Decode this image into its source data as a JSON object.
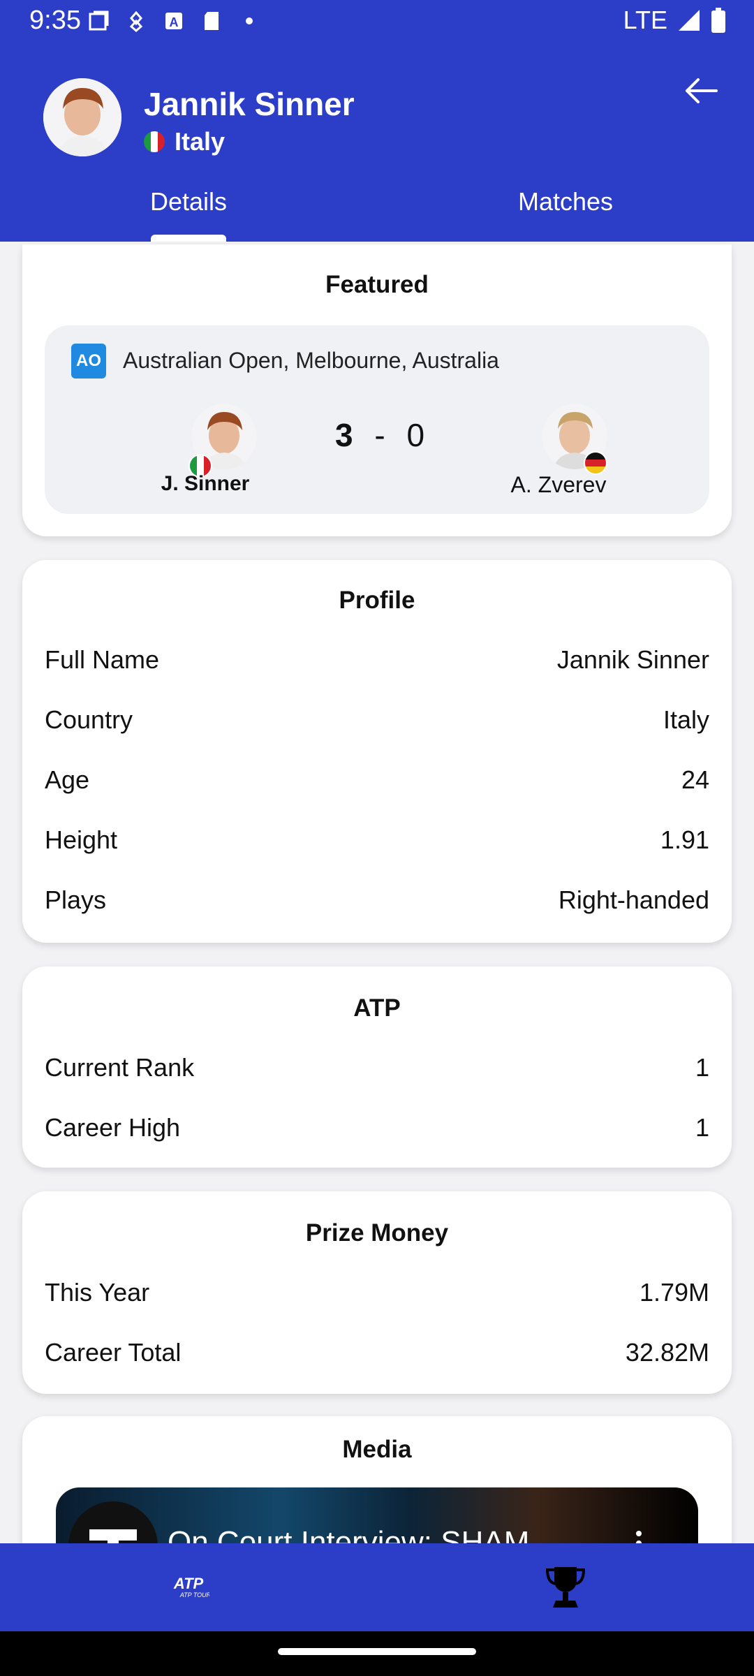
{
  "status_bar": {
    "time": "9:35",
    "network": "LTE"
  },
  "header": {
    "player_name": "Jannik Sinner",
    "country": "Italy",
    "back_icon": "arrow-left-icon"
  },
  "tabs": [
    {
      "label": "Details",
      "active": true
    },
    {
      "label": "Matches",
      "active": false
    }
  ],
  "featured": {
    "title": "Featured",
    "tournament_icon_text": "AO",
    "tournament": "Australian Open, Melbourne, Australia",
    "player1": {
      "name": "J. Sinner",
      "score": "3"
    },
    "score_separator": "-",
    "player2": {
      "name": "A. Zverev",
      "score": "0"
    }
  },
  "profile": {
    "title": "Profile",
    "rows": [
      {
        "label": "Full Name",
        "value": "Jannik Sinner"
      },
      {
        "label": "Country",
        "value": "Italy"
      },
      {
        "label": "Age",
        "value": "24"
      },
      {
        "label": "Height",
        "value": "1.91"
      },
      {
        "label": "Plays",
        "value": "Right-handed"
      }
    ]
  },
  "atp": {
    "title": "ATP",
    "rows": [
      {
        "label": "Current Rank",
        "value": "1"
      },
      {
        "label": "Career High",
        "value": "1"
      }
    ]
  },
  "prize_money": {
    "title": "Prize Money",
    "rows": [
      {
        "label": "This Year",
        "value": "1.79M"
      },
      {
        "label": "Career Total",
        "value": "32.82M"
      }
    ]
  },
  "media": {
    "title": "Media",
    "video_title": "On Court Interview: SHAM"
  },
  "bottom_nav": [
    {
      "icon": "atp-tour-logo-icon",
      "label": "ATP TOUR"
    },
    {
      "icon": "trophy-icon"
    }
  ],
  "colors": {
    "primary": "#2c3dc8",
    "background": "#f2f2f4",
    "card": "#ffffff",
    "match_box": "#f0f1f5"
  }
}
